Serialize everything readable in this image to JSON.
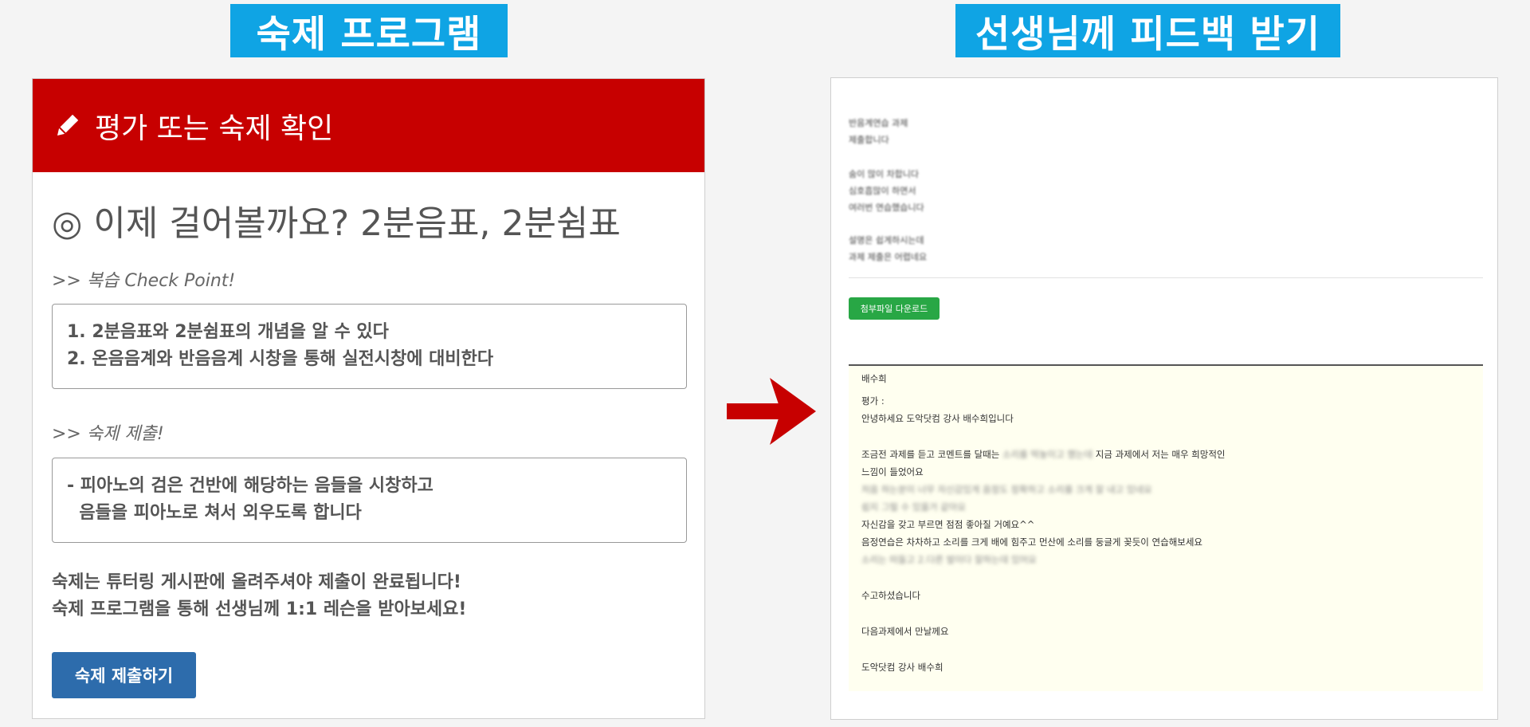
{
  "banners": {
    "left": "숙제 프로그램",
    "right": "선생님께 피드백 받기"
  },
  "left_panel": {
    "header": "평가 또는 숙제 확인",
    "lesson_title": "◎ 이제 걸어볼까요? 2분음표, 2분쉼표",
    "review_label": ">> 복습 Check Point!",
    "review_items": [
      "1. 2분음표와 2분쉼표의 개념을 알 수 있다",
      "2. 온음음계와 반음음계 시창을 통해 실전시창에 대비한다"
    ],
    "submit_label": ">> 숙제 제출!",
    "homework_lines": [
      "- 피아노의 검은 건반에 해당하는 음들을 시창하고",
      "  음들을 피아노로 쳐서 외우도록 합니다"
    ],
    "note_lines": [
      "숙제는 튜터링 게시판에 올려주셔야 제출이 완료됩니다!",
      "숙제 프로그램을 통해 선생님께 1:1 레슨을 받아보세요!"
    ],
    "submit_button": "숙제 제출하기"
  },
  "right_panel": {
    "message_groups": [
      [
        "반음계연습 과제",
        "제출합니다"
      ],
      [
        "숨이 많이 차합니다",
        "심호흡많이 하면서",
        "여러번 연습했습니다"
      ],
      [
        "설명은 쉽게하시는데",
        "과제 제출은 어렵네요"
      ]
    ],
    "download_button": "첨부파일 다운로드",
    "feedback": {
      "author": "배수희",
      "eval_label": "평가 :",
      "greeting": "안녕하세요 도악닷컴 강사 배수희입니다",
      "line1_a": "조금전 과제를 듣고 코멘트를 달때는",
      "line1_blur": "소리를 떡놓이고 했는데",
      "line1_b": "지금 과제에서 저는 매우 희망적인",
      "line2": "느낌이 들었어요",
      "blur_line1": "처음 하는분이 너무 자신감있게 음정도 정확하고 소리를 크게 잘 내고 있네요",
      "blur_line2": "쉽지 그럴 수 있을거 같아요",
      "line3": "자신감을 갖고 부르면 점점 좋아질 거예요^^",
      "line4": "음정연습은 차차하고 소리를 크게 배에 힘주고 먼산에 소리를 둥글게 꽂듯이 연습해보세요",
      "blur_line3": "소리는 떠들고 2.다른 발이다 잘하는데 있어요",
      "closing1": "수고하셨습니다",
      "closing2": "다음과제에서 만날께요",
      "signature": "도악닷컴 강사 배수희"
    }
  },
  "colors": {
    "banner": "#0fa4e4",
    "header_red": "#c70000",
    "submit_blue": "#2d6cac",
    "download_green": "#28a745",
    "feedback_bg": "#fffff0",
    "arrow_red": "#c70000"
  }
}
